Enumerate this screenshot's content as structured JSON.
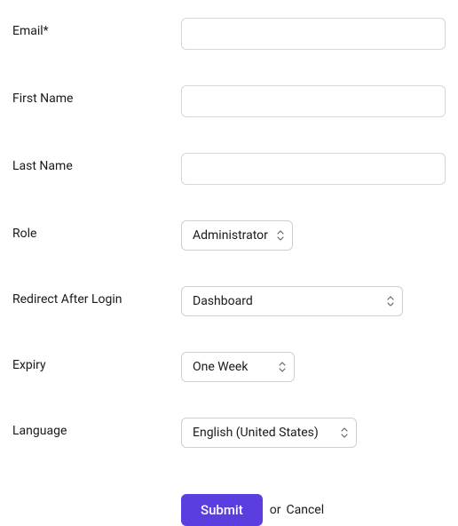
{
  "form": {
    "email": {
      "label": "Email*",
      "value": ""
    },
    "first_name": {
      "label": "First Name",
      "value": ""
    },
    "last_name": {
      "label": "Last Name",
      "value": ""
    },
    "role": {
      "label": "Role",
      "selected": "Administrator"
    },
    "redirect": {
      "label": "Redirect After Login",
      "selected": "Dashboard"
    },
    "expiry": {
      "label": "Expiry",
      "selected": "One Week"
    },
    "language": {
      "label": "Language",
      "selected": "English (United States)"
    }
  },
  "actions": {
    "submit": "Submit",
    "or": "or",
    "cancel": "Cancel"
  }
}
